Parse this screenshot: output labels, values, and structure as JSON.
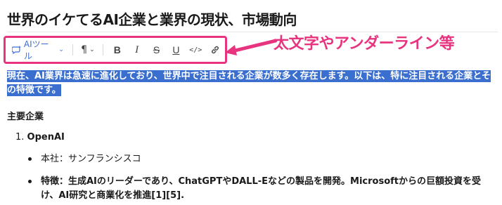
{
  "document": {
    "title": "世界のイケてるAI企業と業界の現状、市場動向",
    "intro_text": "現在、AI業界は急速に進化しており、世界中で注目される企業が数多く存在します。以下は、特に注目される企業とその特徴です。",
    "section_heading": "主要企業",
    "list_item_number": "1.",
    "list_item_name": "OpenAI",
    "bullets": [
      "本社：サンフランシスコ",
      "特徴：生成AIのリーダーであり、ChatGPTやDALL-Eなどの製品を開発。Microsoftからの巨額投資を受け、AI研究と商業化を推進[1][5]."
    ]
  },
  "toolbar": {
    "ai_label": "AIツール",
    "paragraph_glyph": "¶",
    "bold_glyph": "B",
    "italic_glyph": "I",
    "strike_glyph": "S",
    "underline_glyph": "U",
    "code_glyph": "</>",
    "icons": [
      "ai-sparkle-icon",
      "chevron-down-icon",
      "paragraph-icon",
      "bold-icon",
      "italic-icon",
      "strikethrough-icon",
      "underline-icon",
      "code-icon",
      "link-icon"
    ]
  },
  "annotation": {
    "callout_text": "太文字やアンダーライン等",
    "color": "#e8347f"
  },
  "colors": {
    "highlight": "#3a6fd0",
    "ai_accent": "#3b6fd8"
  }
}
